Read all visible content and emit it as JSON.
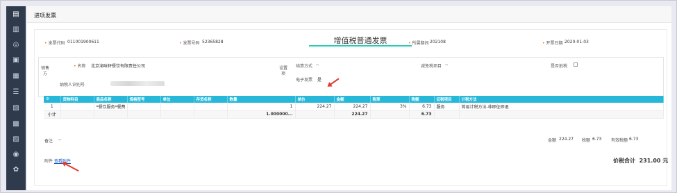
{
  "sidebar": {
    "icons": [
      "file-icon",
      "chart-icon",
      "upload-icon",
      "document-icon",
      "print-icon",
      "layers-icon",
      "image-icon",
      "printer-icon",
      "calendar-icon",
      "user-icon",
      "settings-icon"
    ]
  },
  "page": {
    "title": "进项发票"
  },
  "invoice": {
    "title": "增值税普通发票",
    "code_label": "发票代码",
    "code": "011001900611",
    "number_label": "发票号码",
    "number": "52365828",
    "period_label": "所属期间",
    "period": "202108",
    "date_label": "开票日期",
    "date": "2020-01-03"
  },
  "seller": {
    "tag": "销售方",
    "name_label": "名称",
    "name": "北京渝味轩餐饮有限责任公司",
    "tax_label": "纳税人识别号"
  },
  "settings": {
    "tag": "设置项",
    "method_label": "结算方式",
    "method": "--",
    "reduce_label": "减免税项目",
    "reduce": "--",
    "deduct_label": "是否抵税",
    "electronic_label": "电子发票",
    "electronic": "是"
  },
  "table": {
    "headers": [
      "货物科目",
      "商品名称",
      "规格型号",
      "单位",
      "存货名称",
      "数量",
      "单价",
      "金额",
      "税率",
      "税额",
      "征税项目",
      "计税方法"
    ],
    "rows": [
      [
        "1",
        "",
        "*餐饮服务*餐费",
        "",
        "",
        "",
        "1",
        "224.27",
        "224.27",
        "3%",
        "6.73",
        "服务",
        "简易计税方法-非即征即退"
      ],
      [
        "小计",
        "",
        "",
        "",
        "",
        "",
        "1.000000...",
        "",
        "224.27",
        "",
        "6.73",
        "",
        ""
      ]
    ]
  },
  "remark": {
    "label": "备注",
    "value": "--"
  },
  "summary": {
    "amount_label": "金额",
    "amount": "224.27",
    "tax_label": "税额",
    "tax": "6.73",
    "valid_tax_label": "有效税额",
    "valid_tax": "6.73",
    "total_label": "价税合计",
    "total": "231.00 元"
  },
  "attachment": {
    "label": "附件",
    "link": "查看附件"
  }
}
